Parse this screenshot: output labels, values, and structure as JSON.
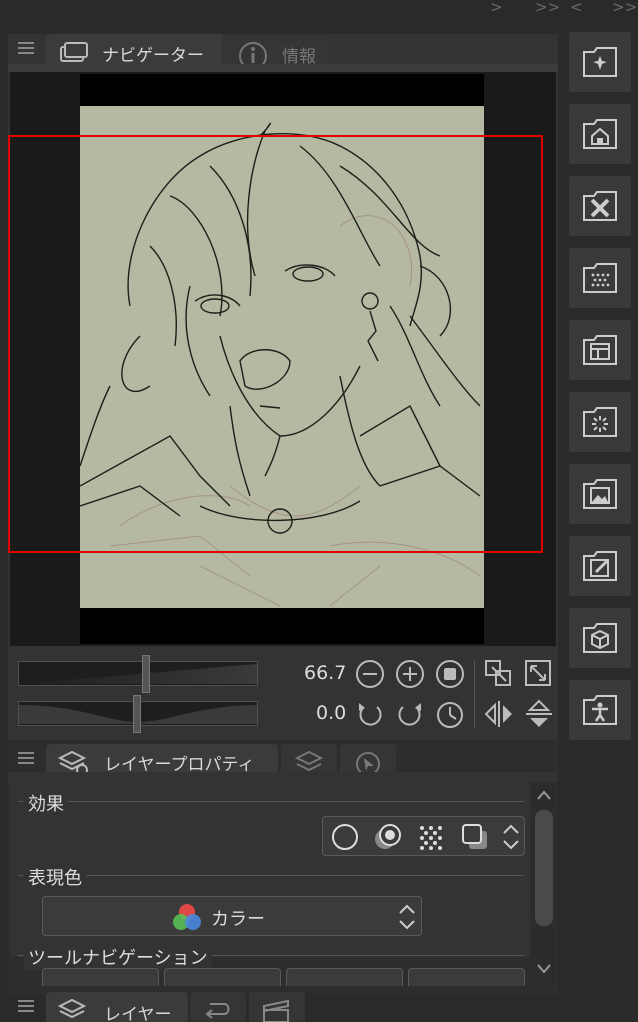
{
  "top_strip": {
    "glyphs": [
      ">",
      ">>",
      "<",
      ">>"
    ]
  },
  "navigator_panel": {
    "tabs": [
      {
        "label": "ナビゲーター",
        "icon": "navigator-icon",
        "active": true
      },
      {
        "label": "情報",
        "icon": "info-icon",
        "active": false
      }
    ],
    "zoom_value": "66.7",
    "rotation_value": "0.0"
  },
  "right_column": {
    "buttons": [
      {
        "icon": "sparkle-folder-icon"
      },
      {
        "icon": "house-folder-icon"
      },
      {
        "icon": "x-folder-icon"
      },
      {
        "icon": "dots-folder-icon"
      },
      {
        "icon": "layout-folder-icon"
      },
      {
        "icon": "burst-folder-icon"
      },
      {
        "icon": "image-folder-icon"
      },
      {
        "icon": "edit-folder-icon"
      },
      {
        "icon": "cube-folder-icon"
      },
      {
        "icon": "figure-folder-icon"
      }
    ]
  },
  "layer_property_panel": {
    "tabs": [
      {
        "label": "レイヤープロパティ",
        "icon": "layer-property-icon",
        "active": true
      },
      {
        "label": "",
        "icon": "layer-stack-icon",
        "active": false
      },
      {
        "label": "",
        "icon": "cursor-icon",
        "active": false
      }
    ],
    "sections": {
      "effect": "効果",
      "expression_color": "表現色",
      "tool_navigation": "ツールナビゲーション"
    },
    "expression_color_value": "カラー"
  },
  "layer_panel": {
    "tabs": [
      {
        "label": "レイヤー",
        "icon": "layers-icon",
        "active": true
      },
      {
        "label": "",
        "icon": "undo-icon",
        "active": false
      },
      {
        "label": "",
        "icon": "film-icon",
        "active": false
      }
    ]
  },
  "colors": {
    "background": "#2a2a2a",
    "panel": "#333333",
    "view_rect": "#e00000",
    "canvas_paper": "#b5b9a1"
  }
}
